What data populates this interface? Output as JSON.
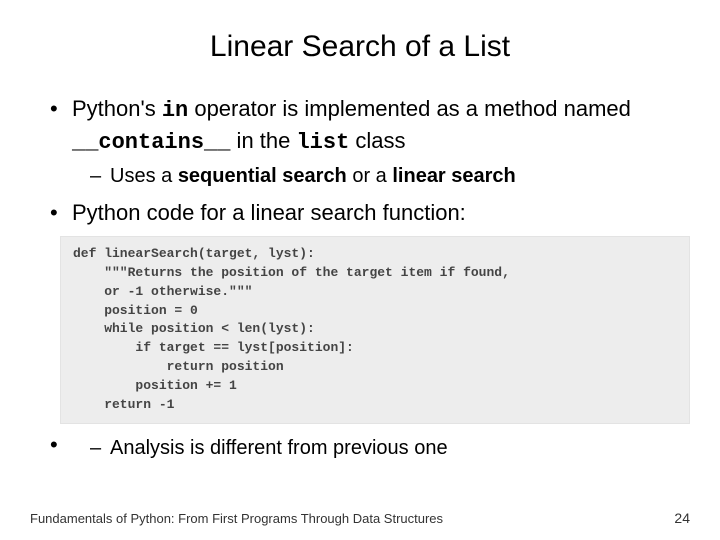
{
  "title": "Linear Search of a List",
  "bullets": {
    "b1_pre": "Python's ",
    "b1_code1": "in",
    "b1_mid1": " operator is implemented as a method named ",
    "b1_code2": "__contains__",
    "b1_mid2": " in the ",
    "b1_code3": "list",
    "b1_post": " class",
    "b1_sub_pre": "Uses a ",
    "b1_sub_bold1": "sequential search",
    "b1_sub_mid": " or a ",
    "b1_sub_bold2": "linear search",
    "b2": "Python code for a linear search function:",
    "b2_sub": "Analysis is different from previous one"
  },
  "code": "def linearSearch(target, lyst):\n    \"\"\"Returns the position of the target item if found,\n    or -1 otherwise.\"\"\"\n    position = 0\n    while position < len(lyst):\n        if target == lyst[position]:\n            return position\n        position += 1\n    return -1",
  "footer": {
    "text": "Fundamentals of Python: From First Programs Through Data Structures",
    "page": "24"
  }
}
